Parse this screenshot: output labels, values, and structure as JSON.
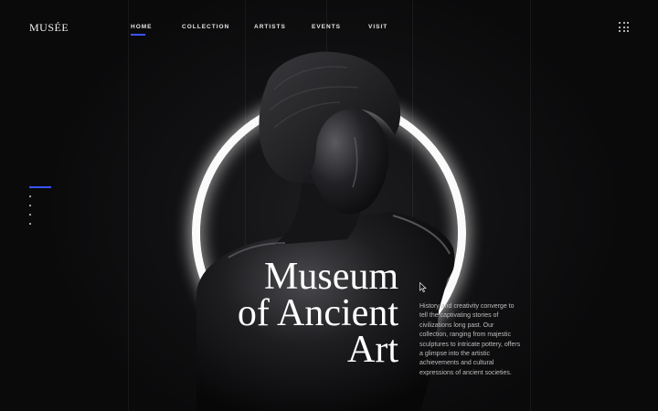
{
  "brand": {
    "logo": "MUSÉE"
  },
  "nav": {
    "items": [
      "HOME",
      "COLLECTION",
      "ARTISTS",
      "EVENTS",
      "VISIT"
    ],
    "active": "HOME",
    "accent_color": "#3b55ff"
  },
  "menu_icon": "grid-dots-icon",
  "slide_indicator": {
    "total": 4,
    "active": 1
  },
  "hero": {
    "title_lines": [
      "Museum",
      "of Ancient",
      "Art"
    ],
    "description": "History and creativity converge to tell the captivating stories of civilizations long past. Our collection, ranging from majestic sculptures to intricate pottery, offers a glimpse into the artistic achievements and cultural expressions of ancient societies."
  }
}
